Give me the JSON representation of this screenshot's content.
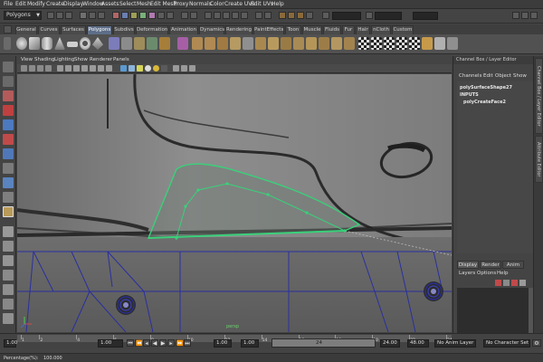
{
  "menubar": [
    "File",
    "Edit",
    "Modify",
    "Create",
    "Display",
    "Window",
    "Assets",
    "Select",
    "Mesh",
    "Edit Mesh",
    "Proxy",
    "Normals",
    "Color",
    "Create UVs",
    "Edit UVs",
    "Help"
  ],
  "statusline": {
    "mode": "Polygons"
  },
  "shelf_tabs": [
    "General",
    "Curves",
    "Surfaces",
    "Polygons",
    "Subdivs",
    "Deformation",
    "Animation",
    "Dynamics",
    "Rendering",
    "PaintEffects",
    "Toon",
    "Muscle",
    "Fluids",
    "Fur",
    "Hair",
    "nCloth",
    "Custom"
  ],
  "shelf_active": "Polygons",
  "viewport": {
    "menus": [
      "View",
      "Shading",
      "Lighting",
      "Show",
      "Renderer",
      "Panels"
    ],
    "camera_label": "persp"
  },
  "channel_box": {
    "title": "Channel Box / Layer Editor",
    "menus": [
      "Channels",
      "Edit",
      "Object",
      "Show"
    ],
    "node": "polySurfaceShape27",
    "inputs_header": "INPUTS",
    "input_node": "polyCreateFace2"
  },
  "side_tabs": [
    "Channel Box / Layer Editor",
    "Attribute Editor"
  ],
  "layer_editor": {
    "tabs": [
      "Display",
      "Render",
      "Anim"
    ],
    "menus": [
      "Layers",
      "Options",
      "Help"
    ]
  },
  "timeline": {
    "ticks": [
      "1",
      "2",
      "4",
      "6",
      "8",
      "10",
      "12",
      "14",
      "16",
      "18",
      "20",
      "22",
      "24"
    ],
    "start": "1.00",
    "current": "1.00",
    "range_start": "1.00",
    "range_start_inner": "1.00",
    "range_end_inner": "24",
    "range_end": "24.00",
    "end": "48.00",
    "anim_layer": "No Anim Layer",
    "character_set": "No Character Set"
  },
  "command_line": {
    "label": "Percentage(%):",
    "value": "100.000"
  },
  "colors": {
    "accent": "#5e6e88",
    "wire": "#3ad07a",
    "edges": "#2a2fa0",
    "panel": "#444444"
  }
}
